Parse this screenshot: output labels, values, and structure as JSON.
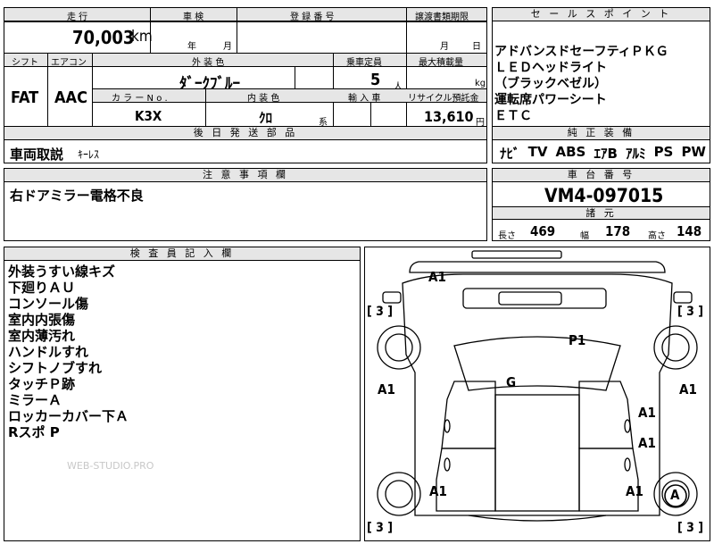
{
  "sheet": {
    "labels": {
      "mileage": "走 行",
      "inspection": "車 検",
      "registration": "登 録 番 号",
      "transfer_limit": "譲渡書類期限",
      "shift": "シフト",
      "aircon": "エアコン",
      "exterior_color": "外 装 色",
      "capacity": "乗車定員",
      "max_load": "最大積載量",
      "color_no": "カ ラ ー N o .",
      "interior_color": "内 装 色",
      "import": "輸 入 車",
      "recycle": "リサイクル預託金",
      "later_parts": "後 日 発 送 部 品",
      "caution": "注 意 事 項 欄",
      "inspector": "検 査 員 記 入 欄",
      "sales_points": "セ ー ル ス ポ イ ン ト",
      "equipment": "純 正 装 備",
      "chassis": "車 台 番 号",
      "dimensions": "諸 元"
    },
    "mileage_value": "70,003",
    "mileage_unit": "km",
    "inspection_year": "年",
    "inspection_month": "月",
    "transfer_month": "月",
    "transfer_day": "日",
    "shift_value": "FAT",
    "aircon_value": "AAC",
    "exterior_value": "ﾀﾞｰｸﾌﾞﾙｰ",
    "capacity_value": "5",
    "capacity_unit": "人",
    "load_unit": "kg",
    "color_no_value": "K3X",
    "interior_value": "ｸﾛ",
    "interior_suffix": "系",
    "recycle_value": "13,610",
    "recycle_unit": "円",
    "later_parts_value": "車両取説",
    "later_parts_extra": "ｷｰﾚｽ",
    "caution_value": "右ドアミラー電格不良",
    "inspector_notes": [
      "外装うすい線キズ",
      "下廻りＡＵ",
      "コンソール傷",
      "室内内張傷",
      "室内薄汚れ",
      "ハンドルすれ",
      "シフトノブすれ",
      "タッチＰ跡",
      "ミラーＡ",
      "ロッカーカバー下Ａ",
      "Rスポ P"
    ],
    "watermark": "WEB-STUDIO.PRO",
    "sales_points_list": [
      "アドバンスドセーフティＰＫＧ",
      "ＬＥＤヘッドライト",
      "（ブラックベゼル）",
      "運転席パワーシート",
      "ＥＴＣ"
    ],
    "equipment_list": [
      "ﾅﾋﾞ",
      "TV",
      "ABS",
      "ｴｱB",
      "ｱﾙﾐ",
      "PS",
      "PW"
    ],
    "chassis_value": "VM4-097015",
    "dim_length_label": "長さ",
    "dim_length": "469",
    "dim_width_label": "幅",
    "dim_width": "178",
    "dim_height_label": "高さ",
    "dim_height": "148"
  },
  "diagram": {
    "marks": {
      "front": "A1",
      "hood": "P1",
      "roof": "G",
      "left_front_fender": "A1",
      "right_front_fender": "A1",
      "right_front_door": "A1",
      "right_rear_door": "A1",
      "left_rear_fender": "A1",
      "right_rear_fender": "A1",
      "right_rear_wheel": "A"
    },
    "tire_tl": "[ 3 ]",
    "tire_tr": "[ 3 ]",
    "tire_bl": "[ 3 ]",
    "tire_br": "[ 3 ]"
  }
}
